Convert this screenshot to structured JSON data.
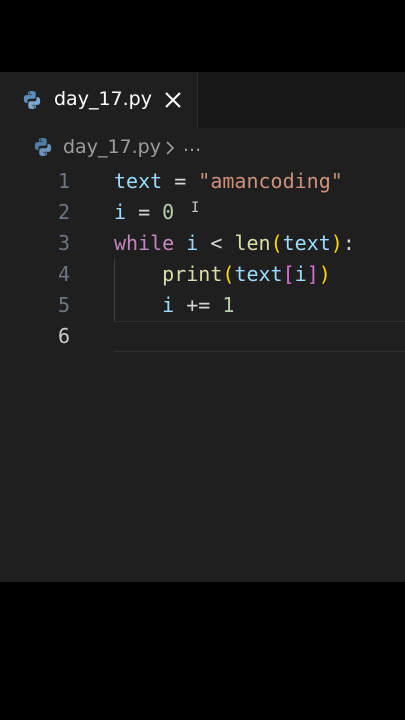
{
  "tab": {
    "label": "day_17.py"
  },
  "breadcrumb": {
    "file": "day_17.py",
    "ellipsis": "..."
  },
  "editor": {
    "lines": [
      {
        "number": "1",
        "tokens": [
          {
            "t": "text",
            "c": "v"
          },
          {
            "t": " = ",
            "c": "op"
          },
          {
            "t": "\"amancoding\"",
            "c": "str"
          }
        ]
      },
      {
        "number": "2",
        "tokens": [
          {
            "t": "i",
            "c": "v"
          },
          {
            "t": " = ",
            "c": "op"
          },
          {
            "t": "0",
            "c": "num"
          }
        ]
      },
      {
        "number": "3",
        "tokens": [
          {
            "t": "while",
            "c": "kw"
          },
          {
            "t": " ",
            "c": "op"
          },
          {
            "t": "i",
            "c": "v"
          },
          {
            "t": " < ",
            "c": "op"
          },
          {
            "t": "len",
            "c": "fn"
          },
          {
            "t": "(",
            "c": "br1"
          },
          {
            "t": "text",
            "c": "v"
          },
          {
            "t": ")",
            "c": "br1"
          },
          {
            "t": ":",
            "c": "op"
          }
        ]
      },
      {
        "number": "4",
        "tokens": [
          {
            "t": "    ",
            "c": "op"
          },
          {
            "t": "print",
            "c": "fn"
          },
          {
            "t": "(",
            "c": "br1"
          },
          {
            "t": "text",
            "c": "v"
          },
          {
            "t": "[",
            "c": "br2"
          },
          {
            "t": "i",
            "c": "v"
          },
          {
            "t": "]",
            "c": "br2"
          },
          {
            "t": ")",
            "c": "br1"
          }
        ]
      },
      {
        "number": "5",
        "tokens": [
          {
            "t": "    ",
            "c": "op"
          },
          {
            "t": "i",
            "c": "v"
          },
          {
            "t": " += ",
            "c": "op"
          },
          {
            "t": "1",
            "c": "num"
          }
        ]
      },
      {
        "number": "6",
        "tokens": []
      }
    ],
    "active_line": "6"
  },
  "colors": {
    "background": "#1f1f1f",
    "variable": "#9cdcfe",
    "string": "#ce9178",
    "number": "#b5cea8",
    "keyword": "#c586c0",
    "function": "#dcdcaa",
    "bracket_level1": "#ffd700",
    "bracket_level2": "#da70d6"
  },
  "icons": {
    "tab_icon": "python-icon",
    "tab_close": "close-icon",
    "breadcrumb_icon": "python-icon",
    "breadcrumb_separator": "chevron-right-icon"
  }
}
